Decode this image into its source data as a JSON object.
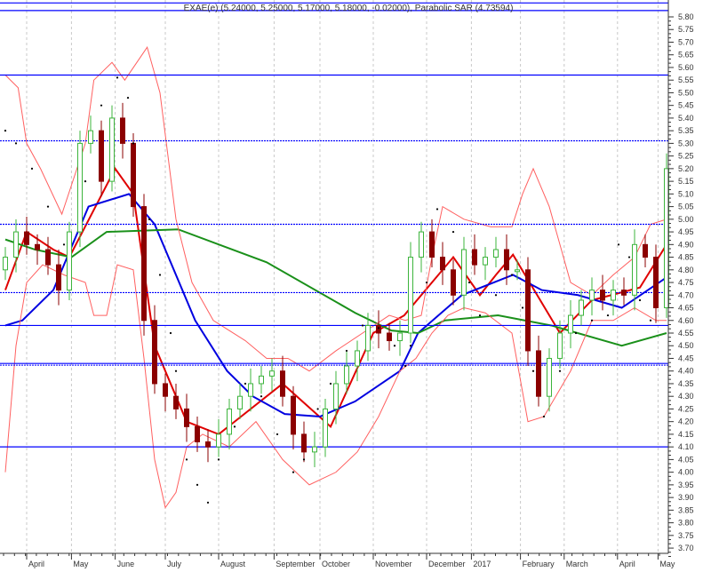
{
  "chart_data": {
    "type": "candlestick",
    "title": "EXAE(e) (5.24000, 5.25000, 5.17000, 5.18000, -0.02000), Parabolic SAR (4.73594)",
    "ylim": [
      3.69,
      5.865
    ],
    "y_ticks_step": 0.05,
    "y_tick_range": [
      3.7,
      5.8
    ],
    "x_labels": [
      {
        "label": "April",
        "idx": 2
      },
      {
        "label": "May",
        "idx": 6.2
      },
      {
        "label": "June",
        "idx": 10.3
      },
      {
        "label": "July",
        "idx": 15
      },
      {
        "label": "August",
        "idx": 20
      },
      {
        "label": "September",
        "idx": 25.2
      },
      {
        "label": "October",
        "idx": 29.5
      },
      {
        "label": "November",
        "idx": 34.5
      },
      {
        "label": "December",
        "idx": 39.5
      },
      {
        "label": "2017",
        "idx": 43.7
      },
      {
        "label": "February",
        "idx": 48.3
      },
      {
        "label": "March",
        "idx": 52.4
      },
      {
        "label": "April",
        "idx": 57.4
      },
      {
        "label": "May",
        "idx": 61.2
      }
    ],
    "closes": [
      4.85,
      4.95,
      4.9,
      4.88,
      4.82,
      4.72,
      4.95,
      5.3,
      5.35,
      5.15,
      5.4,
      5.3,
      5.05,
      4.6,
      4.35,
      4.3,
      4.25,
      4.18,
      4.12,
      4.1,
      4.15,
      4.25,
      4.3,
      4.35,
      4.38,
      4.4,
      4.3,
      4.15,
      4.08,
      4.1,
      4.25,
      4.35,
      4.42,
      4.48,
      4.58,
      4.55,
      4.52,
      4.55,
      4.85,
      4.95,
      4.85,
      4.8,
      4.7,
      4.88,
      4.82,
      4.85,
      4.88,
      4.8,
      4.8,
      4.48,
      4.3,
      4.45,
      4.55,
      4.62,
      4.68,
      4.72,
      4.68,
      4.72,
      4.7,
      4.9,
      4.85,
      4.65,
      5.2
    ],
    "horizontal_levels": [
      {
        "price": 5.855,
        "style": "solid"
      },
      {
        "price": 5.825,
        "style": "solid"
      },
      {
        "price": 5.57,
        "style": "solid"
      },
      {
        "price": 5.31,
        "style": "dotted"
      },
      {
        "price": 4.98,
        "style": "dotted"
      },
      {
        "price": 4.71,
        "style": "dotted"
      },
      {
        "price": 4.58,
        "style": "solid"
      },
      {
        "price": 4.43,
        "style": "double"
      },
      {
        "price": 4.1,
        "style": "solid"
      }
    ],
    "series": [
      {
        "name": "MA short",
        "color": "#e00000",
        "points": [
          [
            0,
            4.72
          ],
          [
            2,
            4.95
          ],
          [
            4.5,
            4.88
          ],
          [
            6,
            4.85
          ],
          [
            10.3,
            5.2
          ],
          [
            12,
            5.1
          ],
          [
            14,
            4.5
          ],
          [
            17,
            4.2
          ],
          [
            20,
            4.15
          ],
          [
            26,
            4.35
          ],
          [
            30.5,
            4.18
          ],
          [
            34.5,
            4.55
          ],
          [
            37.4,
            4.62
          ],
          [
            42,
            4.85
          ],
          [
            44.5,
            4.7
          ],
          [
            46,
            4.78
          ],
          [
            47.6,
            4.86
          ],
          [
            52,
            4.55
          ],
          [
            55,
            4.68
          ],
          [
            59.5,
            4.73
          ],
          [
            62,
            4.9
          ]
        ]
      },
      {
        "name": "MA mid",
        "color": "#0000e0",
        "points": [
          [
            0,
            4.58
          ],
          [
            1.6,
            4.6
          ],
          [
            4.5,
            4.72
          ],
          [
            7.8,
            5.05
          ],
          [
            11.6,
            5.1
          ],
          [
            14,
            4.98
          ],
          [
            17.8,
            4.6
          ],
          [
            20.8,
            4.4
          ],
          [
            23.2,
            4.3
          ],
          [
            26.2,
            4.23
          ],
          [
            29.5,
            4.22
          ],
          [
            32.8,
            4.28
          ],
          [
            37,
            4.4
          ],
          [
            38.7,
            4.55
          ],
          [
            42.8,
            4.7
          ],
          [
            47.6,
            4.78
          ],
          [
            50.3,
            4.72
          ],
          [
            53.7,
            4.7
          ],
          [
            57.8,
            4.65
          ],
          [
            62,
            4.77
          ]
        ]
      },
      {
        "name": "MA long",
        "color": "#1a901a",
        "points": [
          [
            0,
            4.92
          ],
          [
            2.8,
            4.88
          ],
          [
            6.2,
            4.85
          ],
          [
            9.5,
            4.95
          ],
          [
            16.2,
            4.96
          ],
          [
            24.5,
            4.83
          ],
          [
            32.8,
            4.63
          ],
          [
            36.2,
            4.56
          ],
          [
            38.7,
            4.55
          ],
          [
            41.2,
            4.6
          ],
          [
            46.2,
            4.62
          ],
          [
            51.2,
            4.58
          ],
          [
            57.8,
            4.5
          ],
          [
            62,
            4.55
          ]
        ]
      },
      {
        "name": "Bollinger upper",
        "color": "#ff6060",
        "points": [
          [
            0,
            5.57
          ],
          [
            1.2,
            5.52
          ],
          [
            2,
            5.3
          ],
          [
            3.3,
            5.2
          ],
          [
            5.3,
            5.02
          ],
          [
            7.5,
            5.3
          ],
          [
            8.3,
            5.55
          ],
          [
            10,
            5.62
          ],
          [
            11.2,
            5.55
          ],
          [
            13.3,
            5.68
          ],
          [
            14.5,
            5.5
          ],
          [
            16,
            5.0
          ],
          [
            17.5,
            4.75
          ],
          [
            19.5,
            4.6
          ],
          [
            22.5,
            4.52
          ],
          [
            24.5,
            4.45
          ],
          [
            26.5,
            4.45
          ],
          [
            28.5,
            4.4
          ],
          [
            31,
            4.48
          ],
          [
            33.5,
            4.55
          ],
          [
            36,
            4.62
          ],
          [
            37.5,
            4.6
          ],
          [
            39,
            4.62
          ],
          [
            40,
            4.85
          ],
          [
            41,
            5.05
          ],
          [
            43,
            5.0
          ],
          [
            45.5,
            4.97
          ],
          [
            47.5,
            4.97
          ],
          [
            48.5,
            5.1
          ],
          [
            49.5,
            5.2
          ],
          [
            51,
            5.05
          ],
          [
            53,
            4.75
          ],
          [
            55,
            4.7
          ],
          [
            57,
            4.78
          ],
          [
            59,
            4.85
          ],
          [
            60.5,
            4.98
          ],
          [
            62,
            5.0
          ]
        ]
      },
      {
        "name": "Bollinger lower",
        "color": "#ff6060",
        "points": [
          [
            0,
            4.0
          ],
          [
            1,
            4.5
          ],
          [
            2,
            4.75
          ],
          [
            3.5,
            4.82
          ],
          [
            5.5,
            4.78
          ],
          [
            7.5,
            4.75
          ],
          [
            8.3,
            4.62
          ],
          [
            9.5,
            4.62
          ],
          [
            10.5,
            4.82
          ],
          [
            12,
            4.8
          ],
          [
            13,
            4.45
          ],
          [
            14,
            4.05
          ],
          [
            15,
            3.86
          ],
          [
            16,
            3.92
          ],
          [
            17,
            4.1
          ],
          [
            18.5,
            4.15
          ],
          [
            21,
            4.1
          ],
          [
            23.5,
            4.2
          ],
          [
            26,
            4.05
          ],
          [
            28.5,
            3.95
          ],
          [
            31,
            4.0
          ],
          [
            33,
            4.08
          ],
          [
            35,
            4.22
          ],
          [
            37,
            4.4
          ],
          [
            38.5,
            4.45
          ],
          [
            40,
            4.55
          ],
          [
            41.5,
            4.62
          ],
          [
            43,
            4.65
          ],
          [
            45,
            4.63
          ],
          [
            47.5,
            4.55
          ],
          [
            49,
            4.2
          ],
          [
            50.5,
            4.22
          ],
          [
            53,
            4.4
          ],
          [
            55,
            4.6
          ],
          [
            57,
            4.6
          ],
          [
            59,
            4.65
          ],
          [
            61,
            4.6
          ],
          [
            62,
            4.6
          ]
        ]
      }
    ],
    "parabolic_sar": [
      [
        0,
        5.35
      ],
      [
        1,
        5.3
      ],
      [
        2.5,
        5.2
      ],
      [
        4,
        5.05
      ],
      [
        5.5,
        4.9
      ],
      [
        7.5,
        5.15
      ],
      [
        9,
        5.45
      ],
      [
        10.5,
        5.56
      ],
      [
        11.5,
        5.48
      ],
      [
        12,
        5.3
      ],
      [
        13.5,
        5.0
      ],
      [
        14.5,
        4.78
      ],
      [
        15.5,
        4.55
      ],
      [
        16,
        4.4
      ],
      [
        17,
        4.05
      ],
      [
        18,
        3.95
      ],
      [
        19,
        3.88
      ],
      [
        20,
        4.05
      ],
      [
        21.5,
        4.18
      ],
      [
        22.5,
        4.35
      ],
      [
        24,
        4.3
      ],
      [
        25.5,
        4.15
      ],
      [
        27,
        4.0
      ],
      [
        28,
        4.05
      ],
      [
        29.3,
        4.25
      ],
      [
        30.5,
        4.35
      ],
      [
        32,
        4.48
      ],
      [
        33.5,
        4.58
      ],
      [
        35,
        4.57
      ],
      [
        36.5,
        4.5
      ],
      [
        37.5,
        4.42
      ],
      [
        38,
        4.5
      ],
      [
        39.5,
        4.75
      ],
      [
        40.5,
        5.04
      ],
      [
        42,
        4.95
      ],
      [
        43.5,
        4.75
      ],
      [
        44.5,
        4.62
      ],
      [
        46,
        4.7
      ],
      [
        47.5,
        4.78
      ],
      [
        48.5,
        4.65
      ],
      [
        49.5,
        4.4
      ],
      [
        50.5,
        4.22
      ],
      [
        52,
        4.4
      ],
      [
        53.5,
        4.55
      ],
      [
        55,
        4.6
      ],
      [
        56.5,
        4.62
      ],
      [
        57.5,
        4.9
      ],
      [
        58.5,
        4.85
      ],
      [
        59.5,
        4.68
      ],
      [
        60.5,
        4.6
      ]
    ],
    "colors": {
      "up": "#3cb43c",
      "down": "#8b0000",
      "level": "#0000ff",
      "grid": "#c8c8c8",
      "sar": "#000000"
    }
  }
}
